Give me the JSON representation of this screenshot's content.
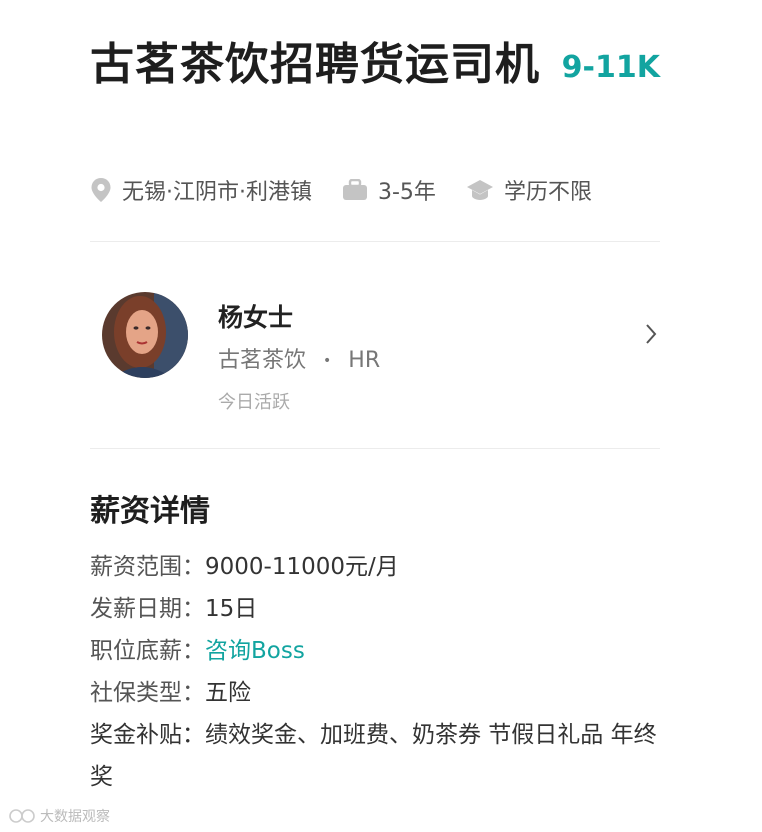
{
  "job": {
    "title": "古茗茶饮招聘货运司机",
    "salary": "9-11K",
    "location": "无锡·江阴市·利港镇",
    "experience": "3-5年",
    "education": "学历不限"
  },
  "hr": {
    "name": "杨女士",
    "company": "古茗茶饮",
    "role": "HR",
    "separator": "•",
    "active_status": "今日活跃"
  },
  "salary_details": {
    "section_title": "薪资详情",
    "rows": [
      {
        "label": "薪资范围：",
        "value": "9000-11000元/月"
      },
      {
        "label": "发薪日期：",
        "value": "15日"
      },
      {
        "label": "职位底薪：",
        "value": "咨询Boss"
      },
      {
        "label": "社保类型：",
        "value": "五险"
      },
      {
        "label": "奖金补贴：",
        "value": "绩效奖金、加班费、奶茶券 节假日礼品 年终奖"
      }
    ]
  },
  "watermark": "大数据观察"
}
